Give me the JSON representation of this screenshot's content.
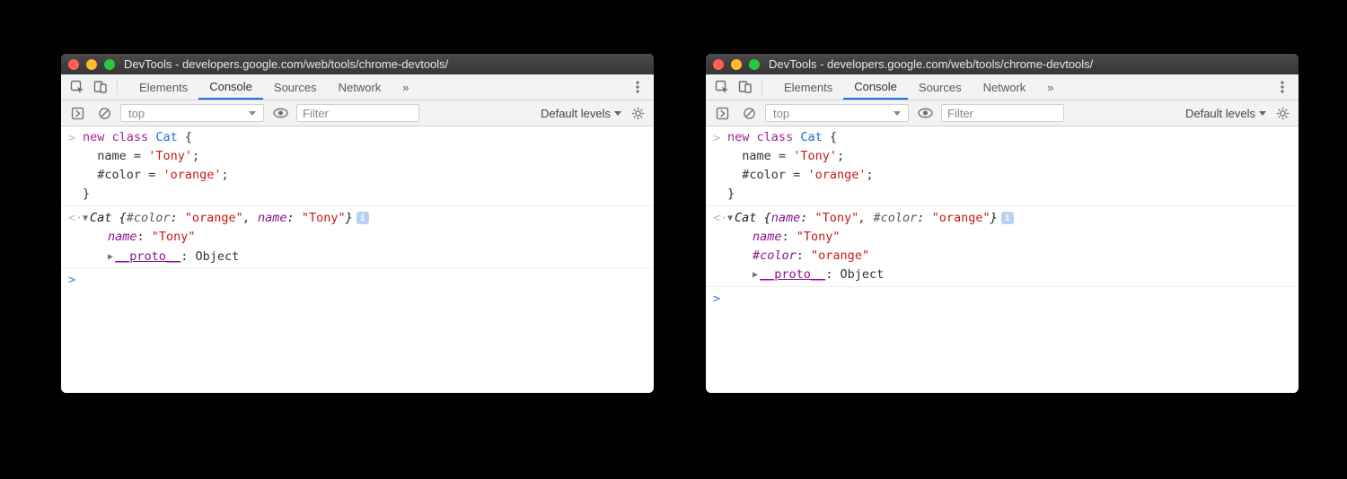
{
  "windows": {
    "leftTitle": "DevTools - developers.google.com/web/tools/chrome-devtools/",
    "rightTitle": "DevTools - developers.google.com/web/tools/chrome-devtools/"
  },
  "tabs": {
    "elements": "Elements",
    "console": "Console",
    "sources": "Sources",
    "network": "Network"
  },
  "toolbar": {
    "context": "top",
    "filterPlaceholder": "Filter",
    "levels": "Default levels"
  },
  "code": {
    "l1a": "new",
    "l1b": " ",
    "l1c": "class",
    "l1d": " ",
    "l1e": "Cat",
    "l1f": " {",
    "l2a": "  name ",
    "l2b": "=",
    "l2c": " ",
    "l2d": "'Tony'",
    "l2e": ";",
    "l3a": "  #color ",
    "l3b": "=",
    "l3c": " ",
    "l3d": "'orange'",
    "l3e": ";",
    "l4a": "}"
  },
  "left": {
    "head": {
      "klass": "Cat ",
      "open": "{",
      "k1": "#color",
      "c1": ": ",
      "v1": "\"orange\"",
      "sep": ", ",
      "k2": "name",
      "c2": ": ",
      "v2": "\"Tony\"",
      "close": "}"
    },
    "prop1": {
      "k": "name",
      "c": ": ",
      "v": "\"Tony\""
    },
    "proto": {
      "k": "__proto__",
      "c": ": ",
      "v": "Object"
    }
  },
  "right": {
    "head": {
      "klass": "Cat ",
      "open": "{",
      "k1": "name",
      "c1": ": ",
      "v1": "\"Tony\"",
      "sep": ", ",
      "k2": "#color",
      "c2": ": ",
      "v2": "\"orange\"",
      "close": "}"
    },
    "prop1": {
      "k": "name",
      "c": ": ",
      "v": "\"Tony\""
    },
    "prop2": {
      "k": "#color",
      "c": ": ",
      "v": "\"orange\""
    },
    "proto": {
      "k": "__proto__",
      "c": ": ",
      "v": "Object"
    }
  }
}
